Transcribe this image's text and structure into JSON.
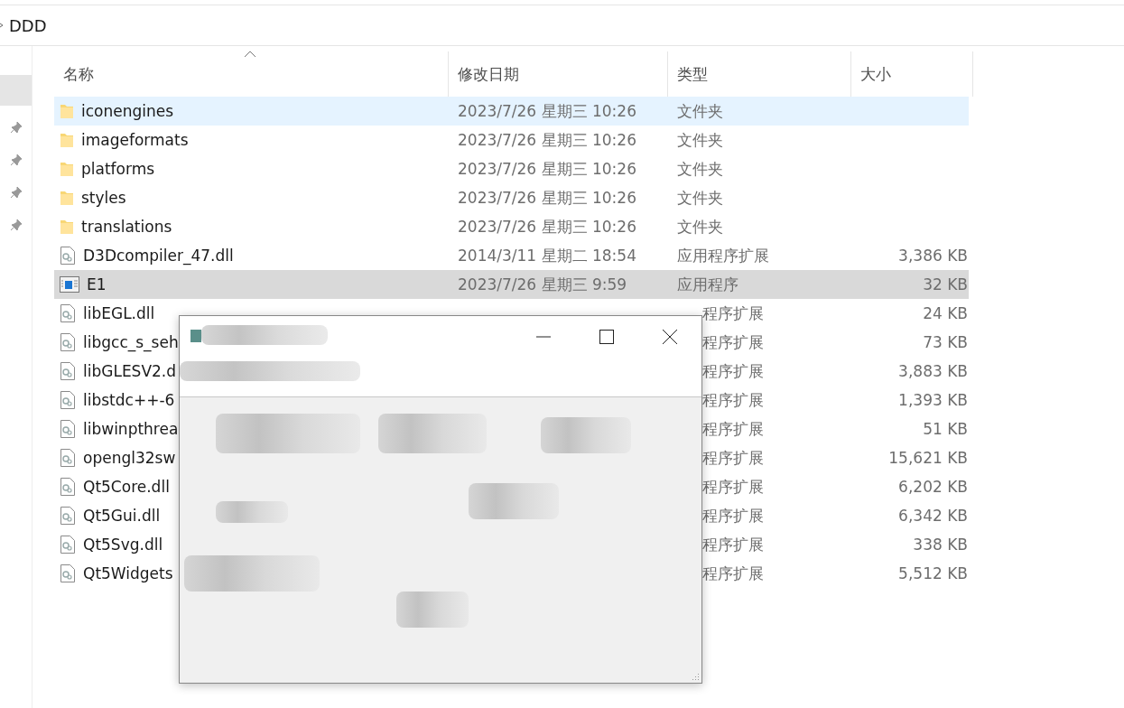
{
  "breadcrumb": {
    "folder": "DDD"
  },
  "columns": [
    {
      "label": "名称",
      "sorted": true
    },
    {
      "label": "修改日期",
      "sorted": false
    },
    {
      "label": "类型",
      "sorted": false
    },
    {
      "label": "大小",
      "sorted": false
    }
  ],
  "rows": [
    {
      "kind": "folder",
      "name": "iconengines",
      "date": "2023/7/26 星期三 10:26",
      "type": "文件夹",
      "hovered": true,
      "selected": false
    },
    {
      "kind": "folder",
      "name": "imageformats",
      "date": "2023/7/26 星期三 10:26",
      "type": "文件夹",
      "hovered": false,
      "selected": false
    },
    {
      "kind": "folder",
      "name": "platforms",
      "date": "2023/7/26 星期三 10:26",
      "type": "文件夹",
      "hovered": false,
      "selected": false
    },
    {
      "kind": "folder",
      "name": "styles",
      "date": "2023/7/26 星期三 10:26",
      "type": "文件夹",
      "hovered": false,
      "selected": false
    },
    {
      "kind": "folder",
      "name": "translations",
      "date": "2023/7/26 星期三 10:26",
      "type": "文件夹",
      "hovered": false,
      "selected": false
    },
    {
      "kind": "dll",
      "name": "D3Dcompiler_47.dll",
      "date": "2014/3/11 星期二 18:54",
      "type": "应用程序扩展",
      "size": "3,386 KB",
      "hovered": false,
      "selected": false
    },
    {
      "kind": "exe",
      "name": "E1",
      "date": "2023/7/26 星期三 9:59",
      "type": "应用程序",
      "size": "32 KB",
      "hovered": false,
      "selected": true
    },
    {
      "kind": "dll",
      "name": "libEGL.dll",
      "type": "程序扩展",
      "size": "24 KB",
      "hovered": false,
      "selected": false
    },
    {
      "kind": "dll",
      "name": "libgcc_s_seh",
      "type": "程序扩展",
      "size": "73 KB",
      "hovered": false,
      "selected": false
    },
    {
      "kind": "dll",
      "name": "libGLESV2.d",
      "type": "程序扩展",
      "size": "3,883 KB",
      "hovered": false,
      "selected": false
    },
    {
      "kind": "dll",
      "name": "libstdc++-6",
      "type": "程序扩展",
      "size": "1,393 KB",
      "hovered": false,
      "selected": false
    },
    {
      "kind": "dll",
      "name": "libwinpthrea",
      "type": "程序扩展",
      "size": "51 KB",
      "hovered": false,
      "selected": false
    },
    {
      "kind": "dll",
      "name": "opengl32sw",
      "type": "程序扩展",
      "size": "15,621 KB",
      "hovered": false,
      "selected": false
    },
    {
      "kind": "dll",
      "name": "Qt5Core.dll",
      "type": "程序扩展",
      "size": "6,202 KB",
      "hovered": false,
      "selected": false
    },
    {
      "kind": "dll",
      "name": "Qt5Gui.dll",
      "type": "程序扩展",
      "size": "6,342 KB",
      "hovered": false,
      "selected": false
    },
    {
      "kind": "dll",
      "name": "Qt5Svg.dll",
      "type": "程序扩展",
      "size": "338 KB",
      "hovered": false,
      "selected": false
    },
    {
      "kind": "dll",
      "name": "Qt5Widgets",
      "type": "程序扩展",
      "size": "5,512 KB",
      "hovered": false,
      "selected": false
    }
  ],
  "nav_pane": {
    "pins": [
      {
        "pinned": true
      },
      {
        "pinned": true
      },
      {
        "pinned": true
      },
      {
        "pinned": true
      }
    ]
  }
}
